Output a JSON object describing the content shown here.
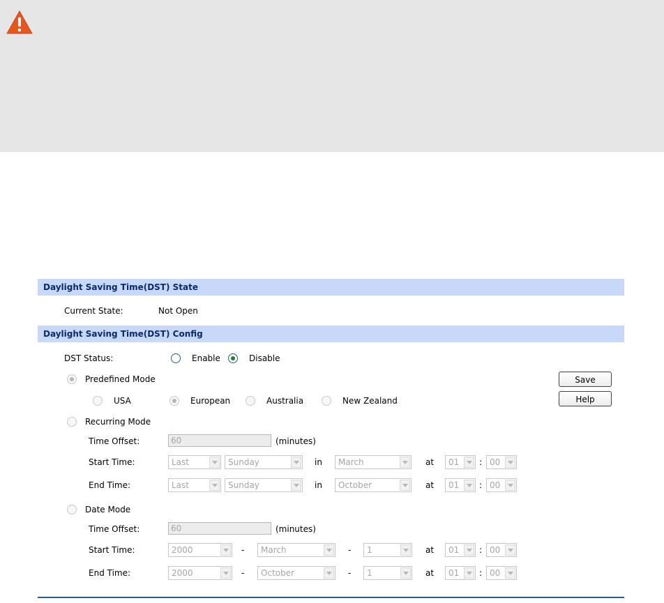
{
  "warning_banner": {
    "icon": "warning-icon",
    "color": "#e8561e"
  },
  "state_section": {
    "title": "Daylight Saving Time(DST) State",
    "current_state_label": "Current State:",
    "current_state_value": "Not Open"
  },
  "config_section": {
    "title": "Daylight Saving Time(DST) Config",
    "dst_status_label": "DST Status:",
    "enable_label": "Enable",
    "disable_label": "Disable",
    "dst_status_selected": "Disable",
    "predefined_mode_label": "Predefined Mode",
    "predefined_options": [
      "USA",
      "European",
      "Australia",
      "New Zealand"
    ],
    "predefined_selected": "European",
    "recurring_mode_label": "Recurring Mode",
    "recurring": {
      "time_offset_label": "Time Offset:",
      "time_offset_value": "60",
      "minutes_label": "(minutes)",
      "start_time_label": "Start Time:",
      "start": {
        "week": "Last",
        "day": "Sunday",
        "month": "March",
        "hour": "01",
        "minute": "00"
      },
      "end_time_label": "End Time:",
      "end": {
        "week": "Last",
        "day": "Sunday",
        "month": "October",
        "hour": "01",
        "minute": "00"
      },
      "in_label": "in",
      "at_label": "at",
      "colon": ":"
    },
    "date_mode_label": "Date Mode",
    "date": {
      "time_offset_label": "Time Offset:",
      "time_offset_value": "60",
      "minutes_label": "(minutes)",
      "start_time_label": "Start Time:",
      "start": {
        "year": "2000",
        "month": "March",
        "day": "1",
        "hour": "01",
        "minute": "00"
      },
      "end_time_label": "End Time:",
      "end": {
        "year": "2000",
        "month": "October",
        "day": "1",
        "hour": "01",
        "minute": "00"
      },
      "dash": "-",
      "at_label": "at",
      "colon": ":"
    }
  },
  "buttons": {
    "save_label": "Save",
    "help_label": "Help"
  },
  "colors": {
    "header_bg": "#c7d8f9",
    "header_text": "#0b2a6a",
    "accent": "#2c5a8f"
  }
}
